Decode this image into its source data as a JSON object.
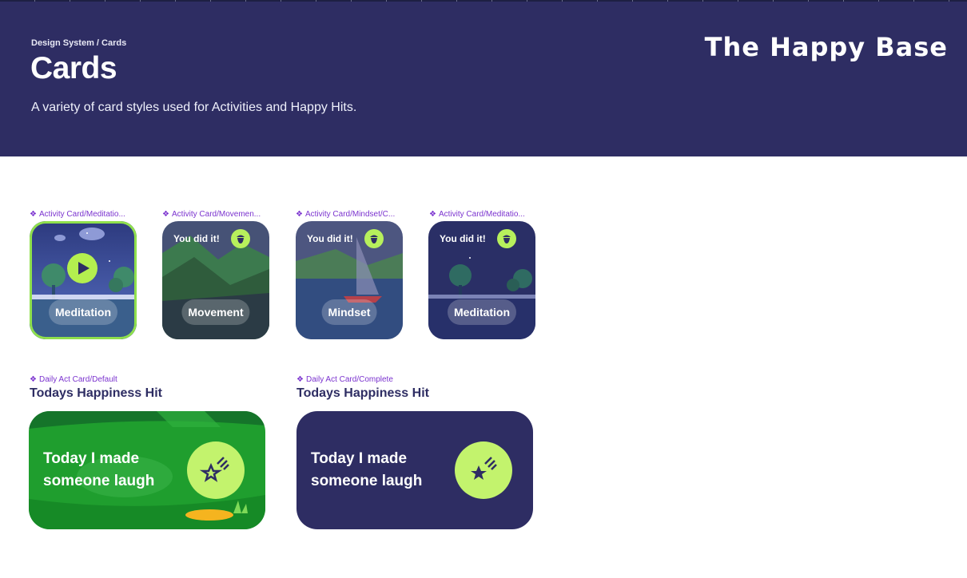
{
  "header": {
    "breadcrumb": "Design System / Cards",
    "title": "Cards",
    "subtitle": "A variety of card styles used for Activities and Happy Hits.",
    "brand": "The Happy Base"
  },
  "colors": {
    "header_bg": "#2e2d63",
    "component_label": "#7b33cf",
    "accent_green": "#b4ef4f",
    "selection_outline": "#8fe04c",
    "hit_complete_bg": "#2e2d63",
    "hit_default_bg": "#1f9e2e"
  },
  "activity_cards": [
    {
      "component_label": "Activity Card/Meditatio...",
      "label": "Meditation",
      "state": "default",
      "icon": "play-icon"
    },
    {
      "component_label": "Activity Card/Movemen...",
      "label": "Movement",
      "badge": "You did it!",
      "state": "complete",
      "icon": "acorn-icon"
    },
    {
      "component_label": "Activity Card/Mindset/C...",
      "label": "Mindset",
      "badge": "You did it!",
      "state": "complete",
      "icon": "acorn-icon"
    },
    {
      "component_label": "Activity Card/Meditatio...",
      "label": "Meditation",
      "badge": "You did it!",
      "state": "complete",
      "icon": "acorn-icon"
    }
  ],
  "daily_cards": [
    {
      "component_label": "Daily Act Card/Default",
      "section_title": "Todays Happiness Hit",
      "text": "Today I made someone laugh",
      "state": "default",
      "icon": "star-icon"
    },
    {
      "component_label": "Daily Act Card/Complete",
      "section_title": "Todays Happiness Hit",
      "text": "Today I made someone laugh",
      "state": "complete",
      "icon": "star-icon"
    }
  ],
  "component_glyph": "❖"
}
